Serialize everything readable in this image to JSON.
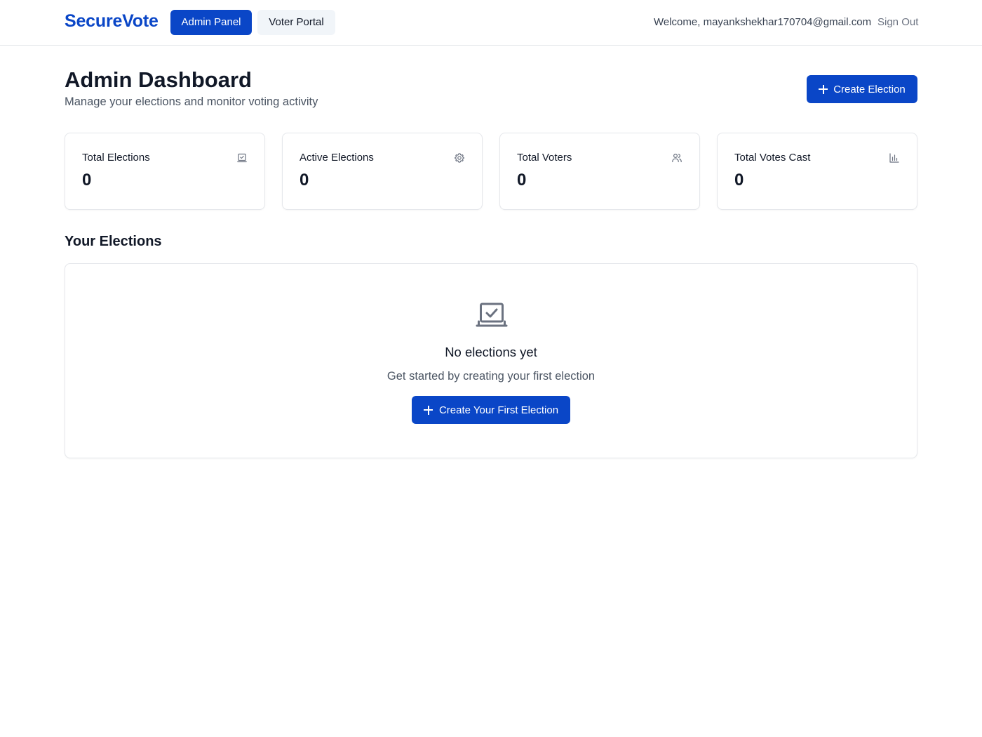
{
  "header": {
    "brand": "SecureVote",
    "nav": [
      {
        "label": "Admin Panel",
        "active": true
      },
      {
        "label": "Voter Portal",
        "active": false
      }
    ],
    "welcome": "Welcome, mayankshekhar170704@gmail.com",
    "sign_out": "Sign Out"
  },
  "page": {
    "title": "Admin Dashboard",
    "subtitle": "Manage your elections and monitor voting activity",
    "create_button": "Create Election"
  },
  "stats": [
    {
      "label": "Total Elections",
      "value": "0",
      "icon": "ballot-box-icon"
    },
    {
      "label": "Active Elections",
      "value": "0",
      "icon": "gear-icon"
    },
    {
      "label": "Total Voters",
      "value": "0",
      "icon": "users-icon"
    },
    {
      "label": "Total Votes Cast",
      "value": "0",
      "icon": "bar-chart-icon"
    }
  ],
  "elections": {
    "section_title": "Your Elections",
    "empty_title": "No elections yet",
    "empty_text": "Get started by creating your first election",
    "empty_button": "Create Your First Election",
    "empty_icon": "ballot-box-icon"
  },
  "colors": {
    "brand": "#0a46c7",
    "secondary_button_bg": "#f1f5f9",
    "border": "#e5e7eb",
    "muted_text": "#4b5563",
    "icon_gray": "#6b7280"
  }
}
